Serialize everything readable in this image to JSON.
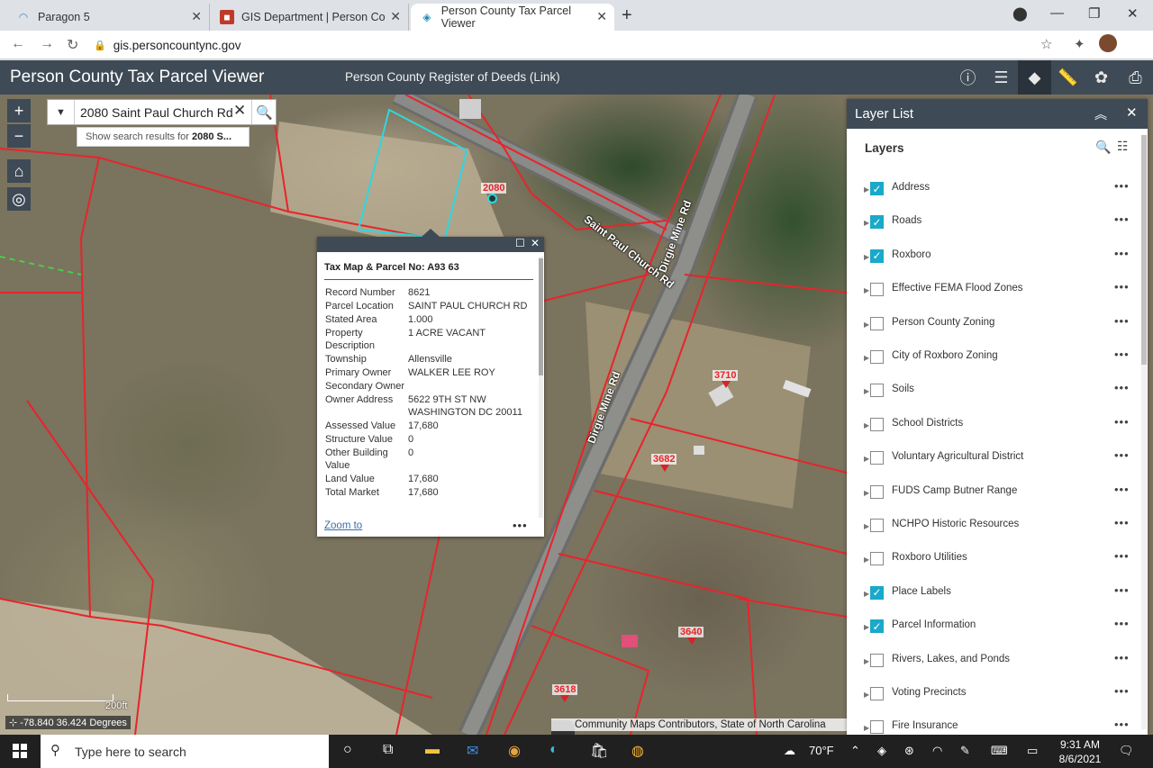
{
  "browser": {
    "tabs": [
      {
        "title": "Paragon 5",
        "icon": "paragon-icon"
      },
      {
        "title": "GIS Department | Person County",
        "icon": "gis-icon"
      },
      {
        "title": "Person County Tax Parcel Viewer",
        "icon": "esri-icon"
      }
    ],
    "url": "gis.personcountync.gov"
  },
  "header": {
    "title": "Person County Tax Parcel Viewer",
    "link": "Person County Register of Deeds (Link)"
  },
  "search": {
    "value": "2080 Saint Paul Church Rd",
    "suggestion_prefix": "Show search results for ",
    "suggestion_bold": "2080 S..."
  },
  "map": {
    "address_labels": [
      "2080",
      "3710",
      "3682",
      "3640",
      "3618"
    ],
    "road_labels": [
      "Saint Paul Church Rd",
      "Dirgie Mine Rd",
      "Dirgie Mine Rd"
    ],
    "scale": "200ft",
    "coords": "-78.840 36.424 Degrees",
    "attribution": "Community Maps Contributors, State of North Carolina"
  },
  "popup": {
    "title": "Tax Map & Parcel No: A93 63",
    "fields": [
      {
        "k": "Record Number",
        "v": "8621"
      },
      {
        "k": "Parcel Location",
        "v": "SAINT PAUL CHURCH RD"
      },
      {
        "k": "Stated Area",
        "v": "1.000"
      },
      {
        "k": "Property Description",
        "v": "1 ACRE VACANT"
      },
      {
        "k": "Township",
        "v": "Allensville"
      },
      {
        "k": "Primary Owner",
        "v": "WALKER LEE ROY"
      },
      {
        "k": "Secondary Owner",
        "v": ""
      },
      {
        "k": "Owner Address",
        "v": "5622 9TH ST NW WASHINGTON DC 20011"
      },
      {
        "k": "Assessed Value",
        "v": "17,680"
      },
      {
        "k": "Structure Value",
        "v": "0"
      },
      {
        "k": "Other Building Value",
        "v": "0"
      },
      {
        "k": "Land Value",
        "v": "17,680"
      },
      {
        "k": "Total Market",
        "v": "17,680"
      }
    ],
    "zoom_to": "Zoom to"
  },
  "layer_list": {
    "title": "Layer List",
    "subtitle": "Layers",
    "layers": [
      {
        "name": "Address",
        "checked": true
      },
      {
        "name": "Roads",
        "checked": true
      },
      {
        "name": "Roxboro",
        "checked": true
      },
      {
        "name": "Effective FEMA Flood Zones",
        "checked": false
      },
      {
        "name": "Person County Zoning",
        "checked": false
      },
      {
        "name": "City of Roxboro Zoning",
        "checked": false
      },
      {
        "name": "Soils",
        "checked": false
      },
      {
        "name": "School Districts",
        "checked": false
      },
      {
        "name": "Voluntary Agricultural District",
        "checked": false
      },
      {
        "name": "FUDS Camp Butner Range",
        "checked": false
      },
      {
        "name": "NCHPO Historic Resources",
        "checked": false
      },
      {
        "name": "Roxboro Utilities",
        "checked": false
      },
      {
        "name": "Place Labels",
        "checked": true
      },
      {
        "name": "Parcel Information",
        "checked": true
      },
      {
        "name": "Rivers, Lakes, and Ponds",
        "checked": false
      },
      {
        "name": "Voting Precincts",
        "checked": false
      },
      {
        "name": "Fire Insurance",
        "checked": false
      }
    ]
  },
  "taskbar": {
    "search_placeholder": "Type here to search",
    "weather": "70°F",
    "time": "9:31 AM",
    "date": "8/6/2021"
  },
  "colors": {
    "header": "#3e4a55",
    "parcel_line": "#e8242b",
    "selected_parcel": "#2fd6e0",
    "checkbox": "#1aa9c8"
  }
}
